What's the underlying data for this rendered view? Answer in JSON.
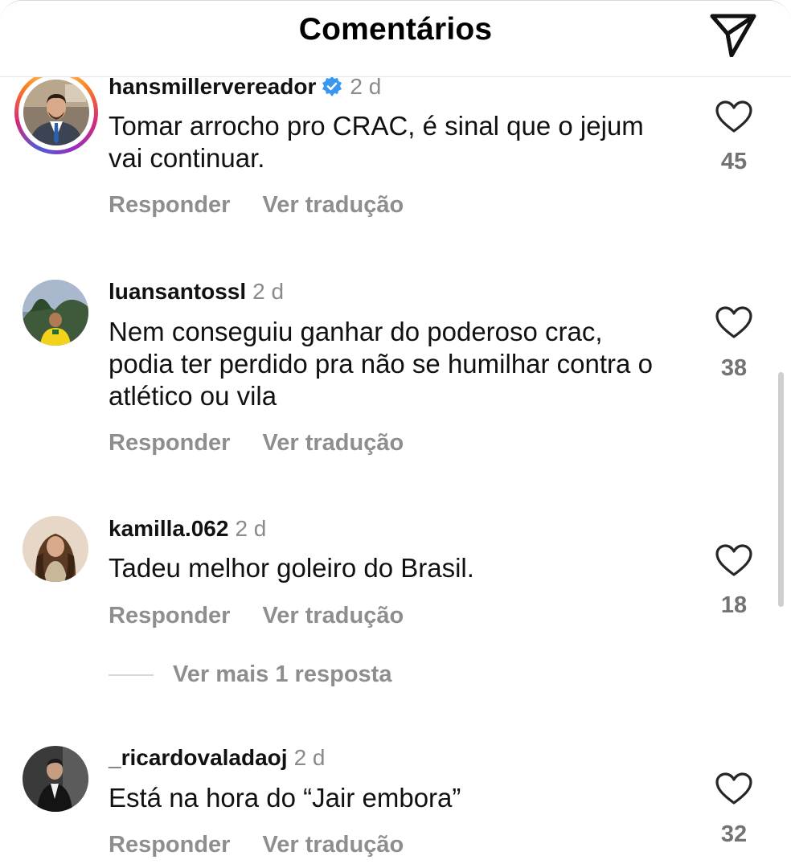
{
  "header": {
    "title": "Comentários",
    "share_icon": "paper-plane-icon"
  },
  "comments": [
    {
      "username": "hansmillervereador",
      "verified": true,
      "time": "2 d",
      "text": "Tomar arrocho pro CRAC, é sinal que o jejum vai continuar.",
      "likes": "45",
      "reply_label": "Responder",
      "translate_label": "Ver tradução",
      "has_story_ring": true
    },
    {
      "username": "luansantossl",
      "verified": false,
      "time": "2 d",
      "text": "Nem conseguiu ganhar do poderoso crac, podia ter perdido pra não se humilhar contra o atlético ou vila",
      "likes": "38",
      "reply_label": "Responder",
      "translate_label": "Ver tradução",
      "has_story_ring": false
    },
    {
      "username": "kamilla.062",
      "verified": false,
      "time": "2 d",
      "text": "Tadeu melhor goleiro do Brasil.",
      "likes": "18",
      "reply_label": "Responder",
      "translate_label": "Ver tradução",
      "has_story_ring": false
    },
    {
      "username": "_ricardovaladaoj",
      "verified": false,
      "time": "2 d",
      "text": "Está na hora do “Jair embora”",
      "likes": "32",
      "reply_label": "Responder",
      "translate_label": "Ver tradução",
      "has_story_ring": false
    }
  ],
  "more_replies": {
    "label": "Ver mais 1 resposta"
  },
  "icons": {
    "like": "heart-icon",
    "verified": "verified-badge-icon"
  },
  "colors": {
    "verified_blue": "#3897f0",
    "muted_text": "#8e8e8e",
    "count_text": "#737373"
  }
}
